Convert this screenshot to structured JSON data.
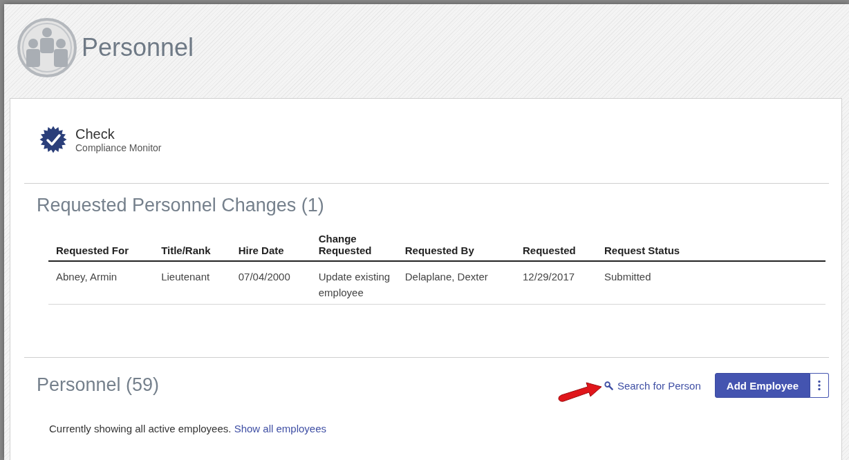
{
  "page": {
    "title": "Personnel"
  },
  "badge": {
    "title": "Check",
    "subtitle": "Compliance Monitor"
  },
  "requests": {
    "heading": "Requested Personnel Changes (1)",
    "columns": [
      "Requested For",
      "Title/Rank",
      "Hire Date",
      "Change Requested",
      "Requested By",
      "Requested",
      "Request Status"
    ],
    "rows": [
      [
        "Abney, Armin",
        "Lieutenant",
        "07/04/2000",
        "Update existing employee",
        "Delaplane, Dexter",
        "12/29/2017",
        "Submitted"
      ]
    ]
  },
  "personnel": {
    "heading": "Personnel (59)",
    "search_link": "Search for Person",
    "add_button": "Add Employee",
    "notice": "Currently showing all active employees.",
    "notice_link": "Show all employees"
  }
}
